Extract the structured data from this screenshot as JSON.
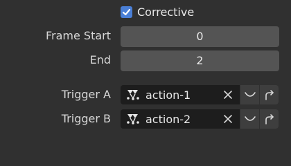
{
  "corrective": {
    "label": "Corrective",
    "checked": true
  },
  "frame_start": {
    "label": "Frame Start",
    "value": "0"
  },
  "frame_end": {
    "label": "End",
    "value": "2"
  },
  "trigger_a": {
    "label": "Trigger A",
    "value": "action-1"
  },
  "trigger_b": {
    "label": "Trigger B",
    "value": "action-2"
  },
  "colors": {
    "background": "#303030",
    "checkbox_accent": "#4a7fd6",
    "field": "#545454",
    "trigger_field": "#1d1d1d"
  },
  "icons": {
    "action": "action-icon",
    "clear": "close-icon",
    "curve": "curve-icon",
    "redo": "redo-icon"
  }
}
